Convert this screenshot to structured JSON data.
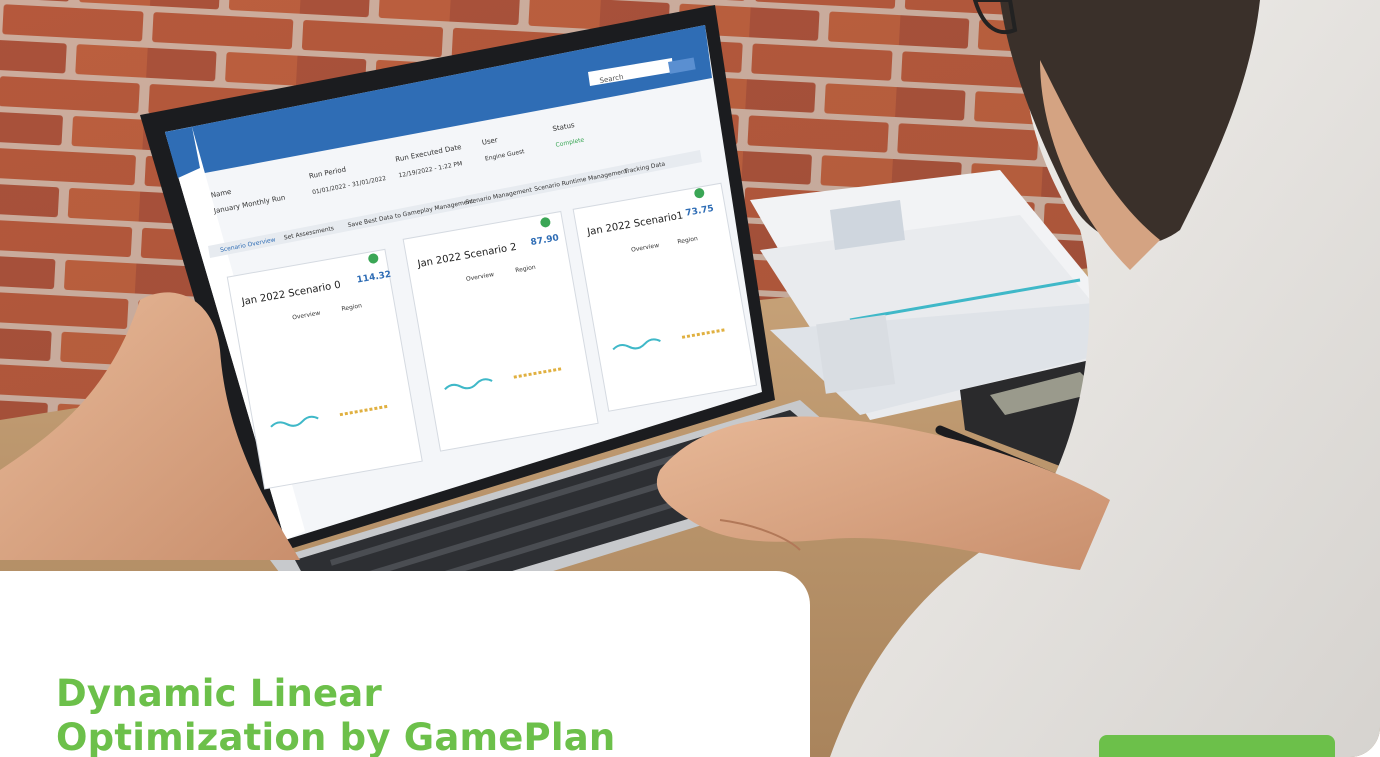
{
  "headline": {
    "line1": "Dynamic Linear",
    "line2": "Optimization by GamePlan"
  },
  "screen": {
    "search_placeholder": "Search",
    "columns": {
      "name_label": "Name",
      "name_value": "January Monthly Run",
      "dates_label": "Run Period",
      "dates_value": "01/01/2022 - 31/01/2022",
      "created_label": "Run Executed Date",
      "created_value": "12/19/2022 - 1:22 PM",
      "user_label": "User",
      "user_value": "Engine Guest",
      "status_label": "Status",
      "status_value": "Complete"
    },
    "toolbar": [
      "Scenario Overview",
      "Set Assessments",
      "Save Best Data to Gameplay Management",
      "Scenario Management",
      "Scenario Runtime Management",
      "Tracking Data"
    ],
    "scenario_cards": [
      {
        "title": "Jan 2022 Scenario 0",
        "score": "114.32",
        "toggle_left": "Overview",
        "toggle_right": "Region"
      },
      {
        "title": "Jan 2022 Scenario 2",
        "score": "87.90",
        "toggle_left": "Overview",
        "toggle_right": "Region"
      },
      {
        "title": "Jan 2022 Scenario1",
        "score": "73.75",
        "toggle_left": "Overview",
        "toggle_right": "Region"
      }
    ]
  },
  "colors": {
    "accent_green": "#6cc04a",
    "app_blue": "#2f6db5"
  }
}
